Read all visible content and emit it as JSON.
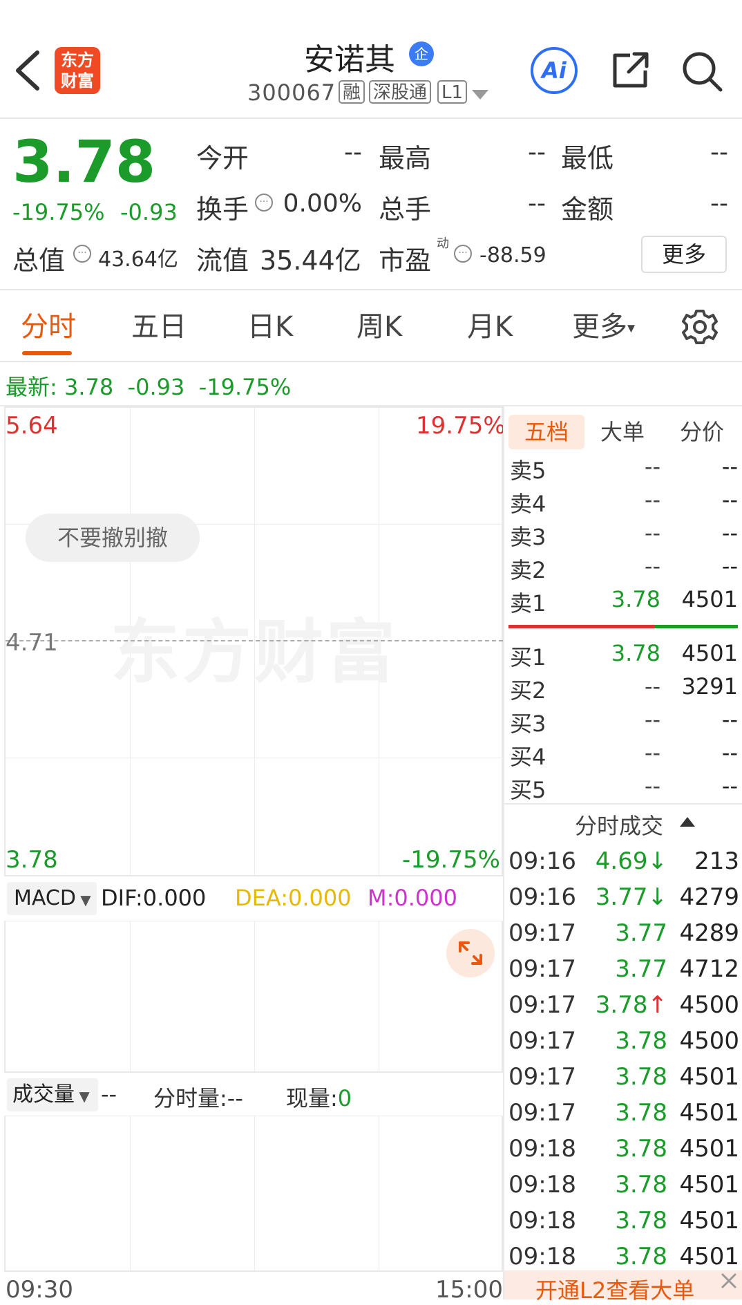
{
  "header": {
    "back_icon": "chevron-left-icon",
    "logo_line1": "东方",
    "logo_line2": "财富",
    "stock_name": "安诺其",
    "enterprise_badge": "企",
    "stock_code": "300067",
    "tags": [
      "融",
      "深股通",
      "L1"
    ],
    "ai_label": "Ai",
    "colors": {
      "brand": "#f04a25",
      "ai": "#2d6ff2"
    }
  },
  "quote": {
    "price": "3.78",
    "change_pct": "-19.75%",
    "change_amt": "-0.93",
    "fields": [
      {
        "label": "今开",
        "value": "--"
      },
      {
        "label": "最高",
        "value": "--"
      },
      {
        "label": "最低",
        "value": "--"
      },
      {
        "label": "换手",
        "value": "0.00%"
      },
      {
        "label": "总手",
        "value": "--"
      },
      {
        "label": "金额",
        "value": "--"
      }
    ],
    "total_value_label": "总值",
    "total_value": "43.64亿",
    "float_value_label": "流值",
    "float_value": "35.44亿",
    "pe_label": "市盈",
    "pe_sup": "动",
    "pe_value": "-88.59",
    "more_button": "更多"
  },
  "tabs": {
    "items": [
      "分时",
      "五日",
      "日K",
      "周K",
      "月K",
      "更多"
    ],
    "active": "分时"
  },
  "latest": {
    "label": "最新:",
    "price": "3.78",
    "change": "-0.93",
    "pct": "-19.75%"
  },
  "chart": {
    "top_price": "5.64",
    "top_pct": "19.75%",
    "mid_price": "4.71",
    "bottom_price": "3.78",
    "bottom_pct": "-19.75%",
    "watermark": "东方财富",
    "pill_text": "不要撤别撤",
    "macd": {
      "select": "MACD",
      "dif": "DIF:0.000",
      "dea": "DEA:0.000",
      "m": "M:0.000"
    },
    "volume": {
      "select": "成交量",
      "value": "--",
      "fs_label": "分时量:--",
      "cur_label": "现量:",
      "cur_value": "0"
    },
    "time_start": "09:30",
    "time_end": "15:00"
  },
  "right_panel": {
    "tabs": [
      "五档",
      "大单",
      "分价"
    ],
    "active_tab": "五档",
    "sell": [
      {
        "label": "卖5",
        "price": "--",
        "vol": "--"
      },
      {
        "label": "卖4",
        "price": "--",
        "vol": "--"
      },
      {
        "label": "卖3",
        "price": "--",
        "vol": "--"
      },
      {
        "label": "卖2",
        "price": "--",
        "vol": "--"
      },
      {
        "label": "卖1",
        "price": "3.78",
        "vol": "4501"
      }
    ],
    "buy": [
      {
        "label": "买1",
        "price": "3.78",
        "vol": "4501"
      },
      {
        "label": "买2",
        "price": "--",
        "vol": "3291"
      },
      {
        "label": "买3",
        "price": "--",
        "vol": "--"
      },
      {
        "label": "买4",
        "price": "--",
        "vol": "--"
      },
      {
        "label": "买5",
        "price": "--",
        "vol": "--"
      }
    ],
    "trades_title": "分时成交",
    "trades": [
      {
        "time": "09:16",
        "price": "4.69",
        "arrow": "↓",
        "vol": "213"
      },
      {
        "time": "09:16",
        "price": "3.77",
        "arrow": "↓",
        "vol": "4279"
      },
      {
        "time": "09:17",
        "price": "3.77",
        "arrow": "",
        "vol": "4289"
      },
      {
        "time": "09:17",
        "price": "3.77",
        "arrow": "",
        "vol": "4712"
      },
      {
        "time": "09:17",
        "price": "3.78",
        "arrow": "↑",
        "vol": "4500"
      },
      {
        "time": "09:17",
        "price": "3.78",
        "arrow": "",
        "vol": "4500"
      },
      {
        "time": "09:17",
        "price": "3.78",
        "arrow": "",
        "vol": "4501"
      },
      {
        "time": "09:17",
        "price": "3.78",
        "arrow": "",
        "vol": "4501"
      },
      {
        "time": "09:18",
        "price": "3.78",
        "arrow": "",
        "vol": "4501"
      },
      {
        "time": "09:18",
        "price": "3.78",
        "arrow": "",
        "vol": "4501"
      },
      {
        "time": "09:18",
        "price": "3.78",
        "arrow": "",
        "vol": "4501"
      },
      {
        "time": "09:18",
        "price": "3.78",
        "arrow": "",
        "vol": "4501"
      }
    ],
    "promo": "开通L2查看大单",
    "colors": {
      "up": "#e03131",
      "down": "#1a9b2a"
    }
  }
}
